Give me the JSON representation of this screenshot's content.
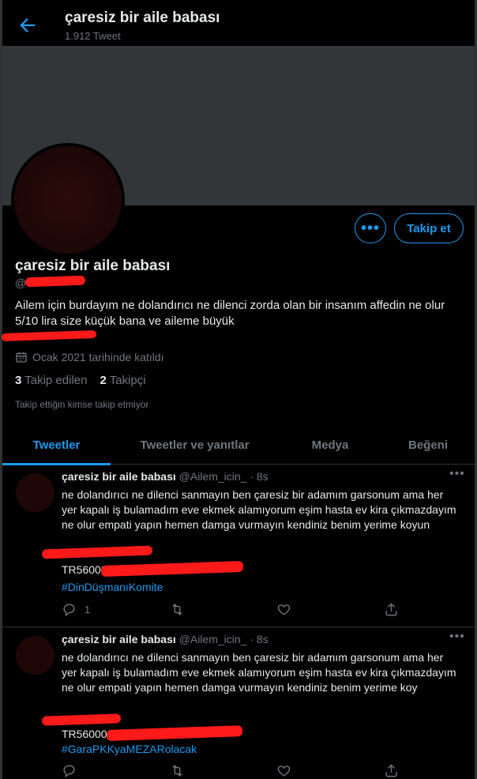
{
  "header": {
    "title": "çaresiz bir aile babası",
    "tweet_count": "1.912 Tweet"
  },
  "profile": {
    "name": "çaresiz bir aile babası",
    "handle_visible": "@",
    "bio": "Ailem için burdayım ne dolandırıcı ne dilenci zorda olan bir insanım affedin ne olur 5/10 lira size küçük bana ve aileme büyük",
    "joined": "Ocak 2021 tarihinde katıldı",
    "following_count": "3",
    "following_label": "Takip edilen",
    "followers_count": "2",
    "followers_label": "Takipçi",
    "note": "Takip ettiğin kimse takip etmiyor",
    "follow_button": "Takip et",
    "more_button": "•••"
  },
  "tabs": [
    "Tweetler",
    "Tweetler ve yanıtlar",
    "Medya",
    "Beğeni"
  ],
  "tweets": [
    {
      "name": "çaresiz bir aile babası",
      "meta": "@Ailem_icin_ · 8s",
      "text": "ne dolandırıcı ne dilenci sanmayın ben çaresiz bir adamım garsonum ama her yer kapalı iş bulamadım eve ekmek alamıyorum eşim hasta ev kira çıkmazdayım ne olur empati yapın hemen damga vurmayın kendiniz benim yerime koyun",
      "iban_prefix": "TR56000",
      "hashtag": "#DinDüşmanıKomite",
      "reply_count": "1"
    },
    {
      "name": "çaresiz bir aile babası",
      "meta": "@Ailem_icin_ · 8s",
      "text": "ne dolandırıcı ne dilenci sanmayın ben çaresiz bir adamım garsonum ama her yer kapalı iş bulamadım eve ekmek alamıyorum eşim hasta ev kira çıkmazdayım ne olur empati yapın hemen damga vurmayın kendiniz benim yerime koy",
      "iban_prefix": "TR560003",
      "hashtag": "#GaraPKKyaMEZARolacak",
      "reply_count": ""
    }
  ],
  "colors": {
    "accent": "#1d9bf0",
    "redaction": "#ff1a1a",
    "banner": "#323638"
  },
  "icons": {
    "back": "arrow-left-icon",
    "calendar": "calendar-icon",
    "reply": "reply-icon",
    "retweet": "retweet-icon",
    "like": "heart-icon",
    "share": "share-icon",
    "more": "more-horizontal-icon"
  }
}
